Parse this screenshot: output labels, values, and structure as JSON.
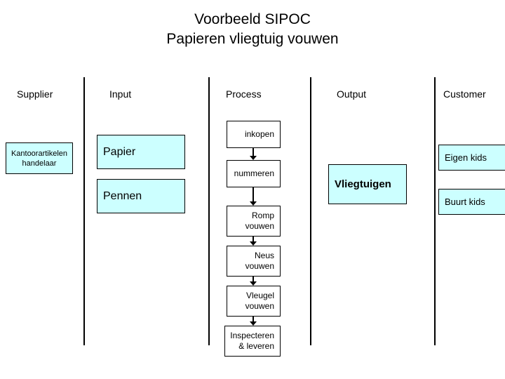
{
  "title": {
    "line1": "Voorbeeld SIPOC",
    "line2": "Papieren vliegtuig vouwen"
  },
  "columns": {
    "supplier": "Supplier",
    "input": "Input",
    "process": "Process",
    "output": "Output",
    "customer": "Customer"
  },
  "supplier_items": [
    {
      "label": "Kantoorartikelen\nhandelaar"
    }
  ],
  "input_items": [
    {
      "label": "Papier"
    },
    {
      "label": "Pennen"
    }
  ],
  "process_steps": [
    {
      "label": "inkopen"
    },
    {
      "label": "nummeren"
    },
    {
      "label": "Romp\nvouwen"
    },
    {
      "label": "Neus\nvouwen"
    },
    {
      "label": "Vleugel\nvouwen"
    },
    {
      "label": "Inspecteren\n& leveren"
    }
  ],
  "output_items": [
    {
      "label": "Vliegtuigen"
    }
  ],
  "customer_items": [
    {
      "label": "Eigen kids"
    },
    {
      "label": "Buurt kids"
    }
  ],
  "colors": {
    "box_fill": "#ccffff",
    "box_border": "#000000",
    "process_fill": "#ffffff",
    "text": "#000000",
    "background": "#ffffff"
  }
}
